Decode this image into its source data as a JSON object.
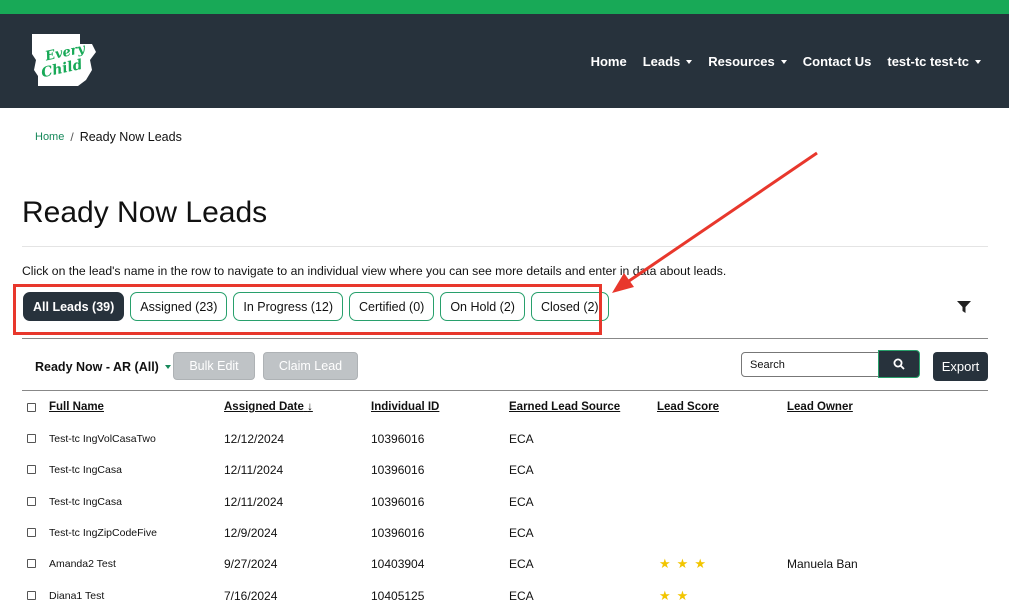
{
  "brand": {
    "logo_text_1": "Every",
    "logo_text_2": "Child",
    "accent_green": "#18a957",
    "navy": "#27323c",
    "alert_red": "#e8372c"
  },
  "nav": {
    "home": "Home",
    "leads": "Leads",
    "resources": "Resources",
    "contact": "Contact Us",
    "user": "test-tc test-tc"
  },
  "breadcrumb": {
    "home": "Home",
    "separator": "/",
    "current": "Ready Now Leads"
  },
  "page": {
    "title": "Ready Now Leads",
    "intro": "Click on the lead's name in the row to navigate to an individual view where you can see more details and enter in data about leads."
  },
  "filters": [
    {
      "label": "All Leads (39)",
      "active": true
    },
    {
      "label": "Assigned (23)",
      "active": false
    },
    {
      "label": "In Progress (12)",
      "active": false
    },
    {
      "label": "Certified (0)",
      "active": false
    },
    {
      "label": "On Hold (2)",
      "active": false
    },
    {
      "label": "Closed (2)",
      "active": false
    }
  ],
  "toolbar": {
    "view_select": "Ready Now - AR (All)",
    "bulk_edit": "Bulk Edit",
    "claim_lead": "Claim Lead",
    "search_placeholder": "Search",
    "export": "Export"
  },
  "table": {
    "columns": [
      "Full Name",
      "Assigned Date",
      "Individual ID",
      "Earned Lead Source",
      "Lead Score",
      "Lead Owner"
    ],
    "sort_indicator": "↓",
    "rows": [
      {
        "name": "Test-tc IngVolCasaTwo",
        "date": "12/12/2024",
        "id": "10396016",
        "source": "ECA",
        "score": 0,
        "owner": ""
      },
      {
        "name": "Test-tc IngCasa",
        "date": "12/11/2024",
        "id": "10396016",
        "source": "ECA",
        "score": 0,
        "owner": ""
      },
      {
        "name": "Test-tc IngCasa",
        "date": "12/11/2024",
        "id": "10396016",
        "source": "ECA",
        "score": 0,
        "owner": ""
      },
      {
        "name": "Test-tc IngZipCodeFive",
        "date": "12/9/2024",
        "id": "10396016",
        "source": "ECA",
        "score": 0,
        "owner": ""
      },
      {
        "name": "Amanda2 Test",
        "date": "9/27/2024",
        "id": "10403904",
        "source": "ECA",
        "score": 3,
        "owner": "Manuela Ban"
      },
      {
        "name": "Diana1 Test",
        "date": "7/16/2024",
        "id": "10405125",
        "source": "ECA",
        "score": 2,
        "owner": ""
      }
    ]
  }
}
